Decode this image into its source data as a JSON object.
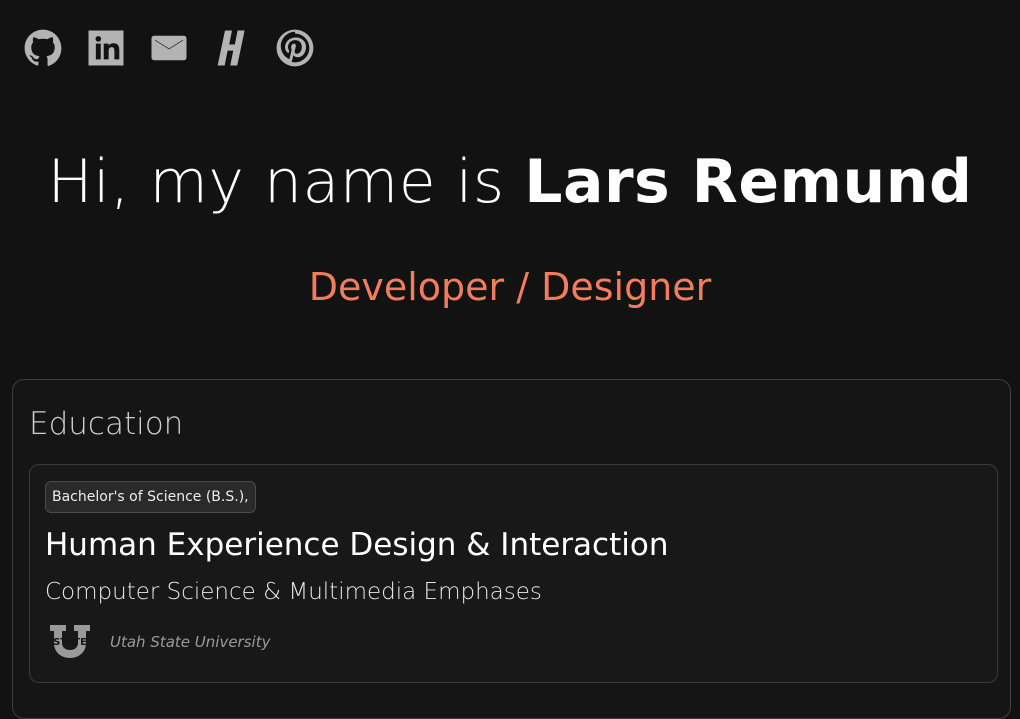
{
  "social_links": [
    {
      "icon": "github-icon",
      "label": "GitHub"
    },
    {
      "icon": "linkedin-icon",
      "label": "LinkedIn"
    },
    {
      "icon": "email-icon",
      "label": "Email"
    },
    {
      "icon": "hashnode-icon",
      "label": "Hashnode"
    },
    {
      "icon": "pinterest-icon",
      "label": "Pinterest"
    }
  ],
  "hero": {
    "greeting": "Hi, my name is ",
    "name": "Lars Remund",
    "subtitle": "Developer / Designer"
  },
  "education": {
    "title": "Education",
    "entry": {
      "degree": "Bachelor's of Science (B.S.),",
      "major": "Human Experience Design & Interaction",
      "emphases": "Computer Science & Multimedia Emphases",
      "school": "Utah State University",
      "school_logo_icon": "usu-state-logo-icon"
    }
  },
  "colors": {
    "background": "#121212",
    "accent": "#f47c5c",
    "icon": "#b3b3b3"
  }
}
